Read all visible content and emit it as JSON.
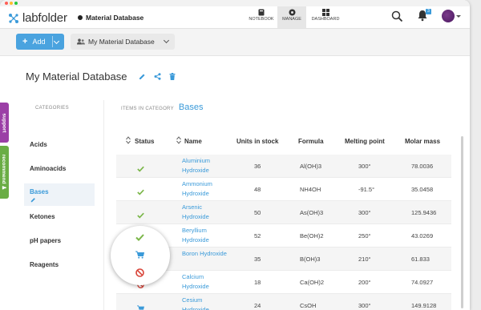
{
  "app": {
    "logo_text": "labfolder"
  },
  "breadcrumb": {
    "title": "Material Database"
  },
  "nav": {
    "tabs": [
      {
        "label": "NOTEBOOK",
        "icon": "notebook-icon"
      },
      {
        "label": "MANAGE",
        "icon": "manage-icon",
        "active": true
      },
      {
        "label": "DASHBOARD",
        "icon": "dashboard-icon"
      }
    ]
  },
  "notifications": {
    "count": "3"
  },
  "toolbar": {
    "add_label": "Add",
    "database_select": "My Material Database"
  },
  "page": {
    "title": "My Material Database"
  },
  "side_tabs": {
    "support": "support",
    "recommend": "recommend ♟"
  },
  "categories": {
    "heading": "CATEGORIES",
    "items": [
      "Acids",
      "Aminoacids",
      "Bases",
      "Ketones",
      "pH papers",
      "Reagents"
    ],
    "active": "Bases"
  },
  "items_in_category": {
    "label": "ITEMS IN CATEGORY",
    "value": "Bases"
  },
  "table": {
    "headers": {
      "status": "Status",
      "name": "Name",
      "units": "Units in stock",
      "formula": "Formula",
      "melting": "Melting point",
      "molar": "Molar mass"
    },
    "rows": [
      {
        "status": "check",
        "name": "Aluminium Hydroxide",
        "units": "36",
        "formula": "Al(OH)3",
        "melting": "300°",
        "molar": "78.0036"
      },
      {
        "status": "check",
        "name": "Ammonium Hydroxide",
        "units": "48",
        "formula": "NH4OH",
        "melting": "-91.5°",
        "molar": "35.0458"
      },
      {
        "status": "check",
        "name": "Arsenic Hydroxide",
        "units": "50",
        "formula": "As(OH)3",
        "melting": "300°",
        "molar": "125.9436"
      },
      {
        "status": "check",
        "name": "Beryllium Hydroxide",
        "units": "52",
        "formula": "Be(OH)2",
        "melting": "250°",
        "molar": "43.0269"
      },
      {
        "status": "cart",
        "name": "Boron Hydroxide",
        "units": "35",
        "formula": "B(OH)3",
        "melting": "210°",
        "molar": "61.833"
      },
      {
        "status": "blocked",
        "name": "Calcium Hydroxide",
        "units": "18",
        "formula": "Ca(OH)2",
        "melting": "200°",
        "molar": "74.0927"
      },
      {
        "status": "cart",
        "name": "Cesium Hydroxide",
        "units": "24",
        "formula": "CsOH",
        "melting": "300°",
        "molar": "149.9128"
      }
    ]
  },
  "colors": {
    "accent": "#3a9ad9",
    "check": "#7ab648",
    "cart": "#3a9ad9",
    "blocked": "#d9453a",
    "support_tab": "#9b3fa6",
    "recommend_tab": "#6aad45"
  }
}
